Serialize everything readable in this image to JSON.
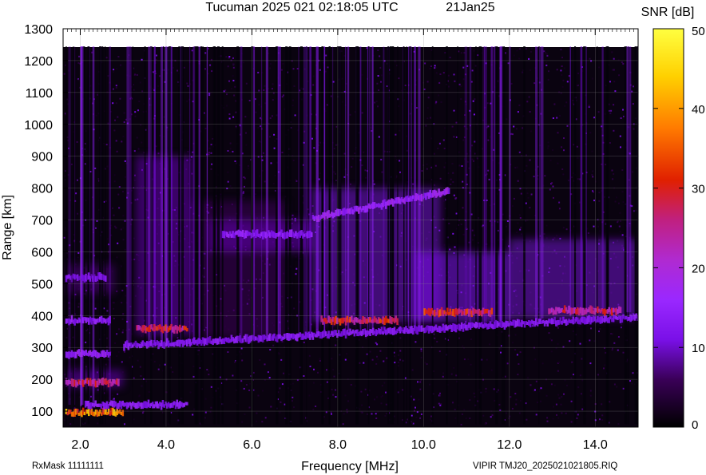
{
  "header": {
    "title": "Tucuman 2025 021 02:18:05 UTC",
    "date": "21Jan25"
  },
  "footer": {
    "rxmask": "RxMask 11111111",
    "file": "VIPIR  TMJ20_2025021021805.RIQ"
  },
  "colorbar": {
    "label": "SNR [dB]",
    "ticks": [
      0,
      10,
      20,
      30,
      40,
      50
    ],
    "range": [
      0,
      50
    ]
  },
  "chart_data": {
    "type": "heatmap",
    "title": "Tucuman 2025 021 02:18:05 UTC",
    "xlabel": "Frequency [MHz]",
    "ylabel": "Range [km]",
    "xlim": [
      1.6,
      15.0
    ],
    "ylim": [
      50,
      1300
    ],
    "xticks": [
      "2.0",
      "4.0",
      "6.0",
      "8.0",
      "10.0",
      "12.0",
      "14.0"
    ],
    "yticks": [
      "100",
      "200",
      "300",
      "400",
      "500",
      "600",
      "700",
      "800",
      "900",
      "1000",
      "1100",
      "1200",
      "1300"
    ],
    "data_top_km": 1245,
    "colormap": [
      "#000000",
      "#3a0058",
      "#7a10e8",
      "#9a28ff",
      "#c02080",
      "#e02000",
      "#ff7a00",
      "#ffd000",
      "#ffff40"
    ],
    "traces": [
      {
        "x": [
          1.65,
          3.0
        ],
        "y": 95,
        "snr": 38
      },
      {
        "x": [
          1.65,
          2.9
        ],
        "y": 190,
        "snr": 26
      },
      {
        "x": [
          1.65,
          2.7
        ],
        "y": 280,
        "snr": 16
      },
      {
        "x": [
          1.65,
          2.7
        ],
        "y": 385,
        "snr": 14
      },
      {
        "x": [
          1.65,
          2.6
        ],
        "y": 520,
        "snr": 12
      },
      {
        "x": [
          2.1,
          4.5
        ],
        "y": 120,
        "snr": 14
      },
      {
        "x": [
          3.0,
          15.0
        ],
        "y": [
          305,
          395
        ],
        "snr": 13
      },
      {
        "x": [
          3.3,
          4.5
        ],
        "y": 360,
        "snr": 28
      },
      {
        "x": [
          7.6,
          9.4
        ],
        "y": 385,
        "snr": 29
      },
      {
        "x": [
          10.0,
          11.6
        ],
        "y": 410,
        "snr": 30
      },
      {
        "x": [
          12.9,
          14.6
        ],
        "y": 415,
        "snr": 26
      },
      {
        "x": [
          5.3,
          7.4
        ],
        "y": 655,
        "snr": 14
      },
      {
        "x": [
          7.4,
          10.6
        ],
        "y": [
          705,
          790
        ],
        "snr": 16
      }
    ]
  }
}
